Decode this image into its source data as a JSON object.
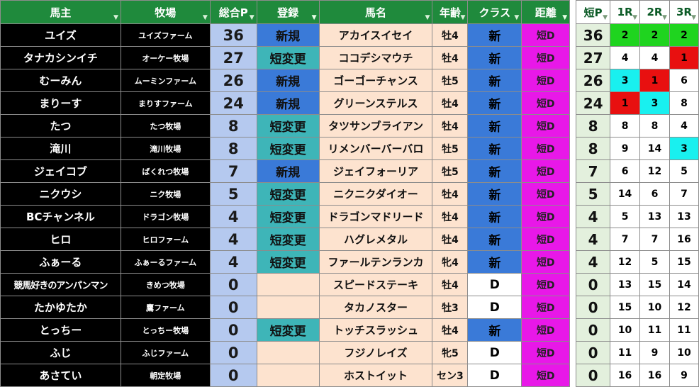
{
  "headers": {
    "owner": "馬主",
    "farm": "牧場",
    "total_p": "総合P",
    "registration": "登録",
    "horse_name": "馬名",
    "age": "年齢",
    "class": "クラス",
    "distance": "距離",
    "short_p": "短P",
    "r1": "1R",
    "r2": "2R",
    "r3": "3R"
  },
  "colors": {
    "header_green": "#1f8a3c",
    "new_blue": "#3a7ad8",
    "change_teal": "#3eb5b8",
    "peach": "#fde3cf",
    "magenta": "#e818e8",
    "points_blue": "#b5c9ef",
    "short_p_green": "#e3f0dd",
    "rank_green": "#1fd41f",
    "rank_red": "#e81010",
    "rank_cyan": "#19f0ef"
  },
  "rows": [
    {
      "owner": "ユイズ",
      "farm": "ユイズファーム",
      "total_p": "36",
      "registration": "新規",
      "horse": "アカイスイセイ",
      "age": "牡4",
      "class": "新",
      "distance": "短D",
      "short_p": "36",
      "r1": "2",
      "r2": "2",
      "r3": "2"
    },
    {
      "owner": "タナカシンイチ",
      "farm": "オーケー牧場",
      "total_p": "27",
      "registration": "短変更",
      "horse": "ココデシマウチ",
      "age": "牡4",
      "class": "新",
      "distance": "短D",
      "short_p": "27",
      "r1": "4",
      "r2": "4",
      "r3": "1"
    },
    {
      "owner": "むーみん",
      "farm": "ムーミンファーム",
      "total_p": "26",
      "registration": "新規",
      "horse": "ゴーゴーチャンス",
      "age": "牡5",
      "class": "新",
      "distance": "短D",
      "short_p": "26",
      "r1": "3",
      "r2": "1",
      "r3": "6"
    },
    {
      "owner": "まりーす",
      "farm": "まりすファーム",
      "total_p": "24",
      "registration": "新規",
      "horse": "グリーンステルス",
      "age": "牡4",
      "class": "新",
      "distance": "短D",
      "short_p": "24",
      "r1": "1",
      "r2": "3",
      "r3": "8"
    },
    {
      "owner": "たつ",
      "farm": "たつ牧場",
      "total_p": "8",
      "registration": "短変更",
      "horse": "タツサンブライアン",
      "age": "牡4",
      "class": "新",
      "distance": "短D",
      "short_p": "8",
      "r1": "8",
      "r2": "8",
      "r3": "4"
    },
    {
      "owner": "滝川",
      "farm": "滝川牧場",
      "total_p": "8",
      "registration": "短変更",
      "horse": "リメンバーバーバロ",
      "age": "牡5",
      "class": "新",
      "distance": "短D",
      "short_p": "8",
      "r1": "9",
      "r2": "14",
      "r3": "3"
    },
    {
      "owner": "ジェイコブ",
      "farm": "ばくれつ牧場",
      "total_p": "7",
      "registration": "新規",
      "horse": "ジェイフォーリア",
      "age": "牡5",
      "class": "新",
      "distance": "短D",
      "short_p": "7",
      "r1": "6",
      "r2": "12",
      "r3": "5"
    },
    {
      "owner": "ニクウシ",
      "farm": "ニク牧場",
      "total_p": "5",
      "registration": "短変更",
      "horse": "ニクニクダイオー",
      "age": "牡4",
      "class": "新",
      "distance": "短D",
      "short_p": "5",
      "r1": "14",
      "r2": "6",
      "r3": "7"
    },
    {
      "owner": "BCチャンネル",
      "farm": "ドラゴン牧場",
      "total_p": "4",
      "registration": "短変更",
      "horse": "ドラゴンマドリード",
      "age": "牡4",
      "class": "新",
      "distance": "短D",
      "short_p": "4",
      "r1": "5",
      "r2": "13",
      "r3": "13"
    },
    {
      "owner": "ヒロ",
      "farm": "ヒロファーム",
      "total_p": "4",
      "registration": "短変更",
      "horse": "ハグレメタル",
      "age": "牡4",
      "class": "新",
      "distance": "短D",
      "short_p": "4",
      "r1": "7",
      "r2": "7",
      "r3": "16"
    },
    {
      "owner": "ふぁーる",
      "farm": "ふぁーるファーム",
      "total_p": "4",
      "registration": "短変更",
      "horse": "ファールテンランカ",
      "age": "牝4",
      "class": "新",
      "distance": "短D",
      "short_p": "4",
      "r1": "12",
      "r2": "5",
      "r3": "15"
    },
    {
      "owner": "競馬好きのアンパンマン",
      "farm": "きめつ牧場",
      "total_p": "0",
      "registration": "",
      "horse": "スピードステーキ",
      "age": "牡4",
      "class": "D",
      "distance": "短D",
      "short_p": "0",
      "r1": "13",
      "r2": "15",
      "r3": "14"
    },
    {
      "owner": "たかゆたか",
      "farm": "鷹ファーム",
      "total_p": "0",
      "registration": "",
      "horse": "タカノスター",
      "age": "牡3",
      "class": "D",
      "distance": "短D",
      "short_p": "0",
      "r1": "15",
      "r2": "10",
      "r3": "12"
    },
    {
      "owner": "とっちー",
      "farm": "とっちー牧場",
      "total_p": "0",
      "registration": "短変更",
      "horse": "トッチスラッシュ",
      "age": "牡4",
      "class": "新",
      "distance": "短D",
      "short_p": "0",
      "r1": "10",
      "r2": "11",
      "r3": "11"
    },
    {
      "owner": "ふじ",
      "farm": "ふじファーム",
      "total_p": "0",
      "registration": "",
      "horse": "フジノレイズ",
      "age": "牝5",
      "class": "D",
      "distance": "短D",
      "short_p": "0",
      "r1": "11",
      "r2": "9",
      "r3": "10"
    },
    {
      "owner": "あさてい",
      "farm": "朝定牧場",
      "total_p": "0",
      "registration": "",
      "horse": "ホストイット",
      "age": "セン3",
      "class": "D",
      "distance": "短D",
      "short_p": "0",
      "r1": "16",
      "r2": "16",
      "r3": "9"
    }
  ]
}
